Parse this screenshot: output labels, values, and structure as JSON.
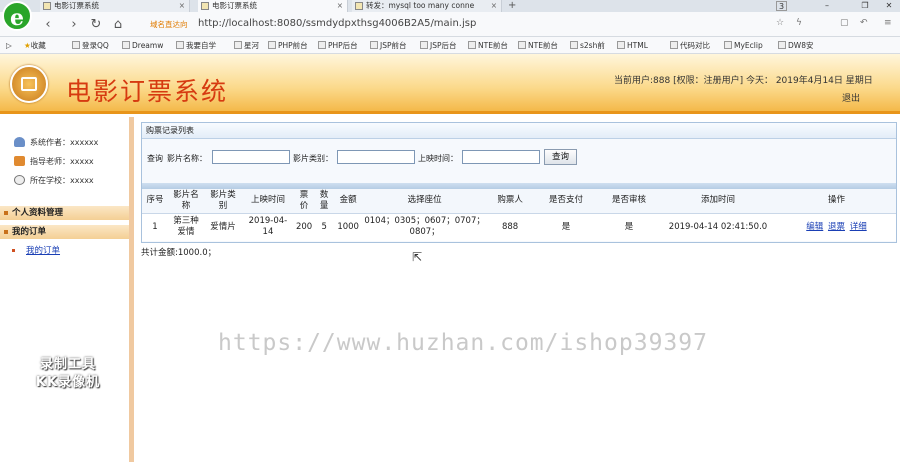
{
  "browser": {
    "tabs": [
      {
        "title": "电影订票系统"
      },
      {
        "title": "电影订票系统"
      },
      {
        "title": "转发：mysql too many conne"
      }
    ],
    "new_tab": "+",
    "window_badge": "3",
    "url_hint": "域名直达向",
    "url": "http://localhost:8080/ssmdydpxthsg4006B2A5/main.jsp",
    "bookmarks": [
      "收藏",
      "登录QQ",
      "Dreamw",
      "我要自学",
      "星河",
      "PHP前台",
      "PHP后台",
      "JSP前台",
      "JSP后台",
      "NTE前台",
      "NTE前台",
      "s2sh前",
      "HTML",
      "代码对比",
      "MyEclip",
      "DW8安"
    ]
  },
  "header": {
    "title": "电影订票系统",
    "user_info": "当前用户:888 [权限：注册用户] 今天： 2019年4月14日 星期日",
    "logout": "退出"
  },
  "sidebar": {
    "info": [
      {
        "text": "系统作者：xxxxxx"
      },
      {
        "text": "指导老师：xxxxx"
      },
      {
        "text": "所在学校：xxxxx"
      }
    ],
    "menus": [
      {
        "label": "个人资料管理"
      },
      {
        "label": "我的订单"
      }
    ],
    "submenu": {
      "label": "我的订单"
    }
  },
  "panel": {
    "title": "购票记录列表",
    "search": {
      "prefix": "查询",
      "movie_name_label": "影片名称：",
      "movie_type_label": "影片类别：",
      "show_time_label": "上映时间：",
      "button": "查询"
    },
    "columns": [
      "序号",
      "影片名称",
      "影片类别",
      "上映时间",
      "票价",
      "数量",
      "金额",
      "选择座位",
      "购票人",
      "是否支付",
      "是否审核",
      "添加时间",
      "操作"
    ],
    "rows": [
      {
        "no": "1",
        "name": "第三种爱情",
        "type": "爱情片",
        "show_time": "2019-04-14",
        "price": "200",
        "qty": "5",
        "amount": "1000",
        "seats": "0104；0305；0607；0707；0807；",
        "buyer": "888",
        "paid": "是",
        "audited": "是",
        "added": "2019-04-14 02:41:50.0",
        "actions": [
          "编辑",
          "退票",
          "详细"
        ]
      }
    ],
    "total": "共计金额:1000.0；"
  },
  "overlay": {
    "watermark": "https://www.huzhan.com/ishop39397",
    "recorder_line1": "录制工具",
    "recorder_line2": "KK录像机"
  }
}
